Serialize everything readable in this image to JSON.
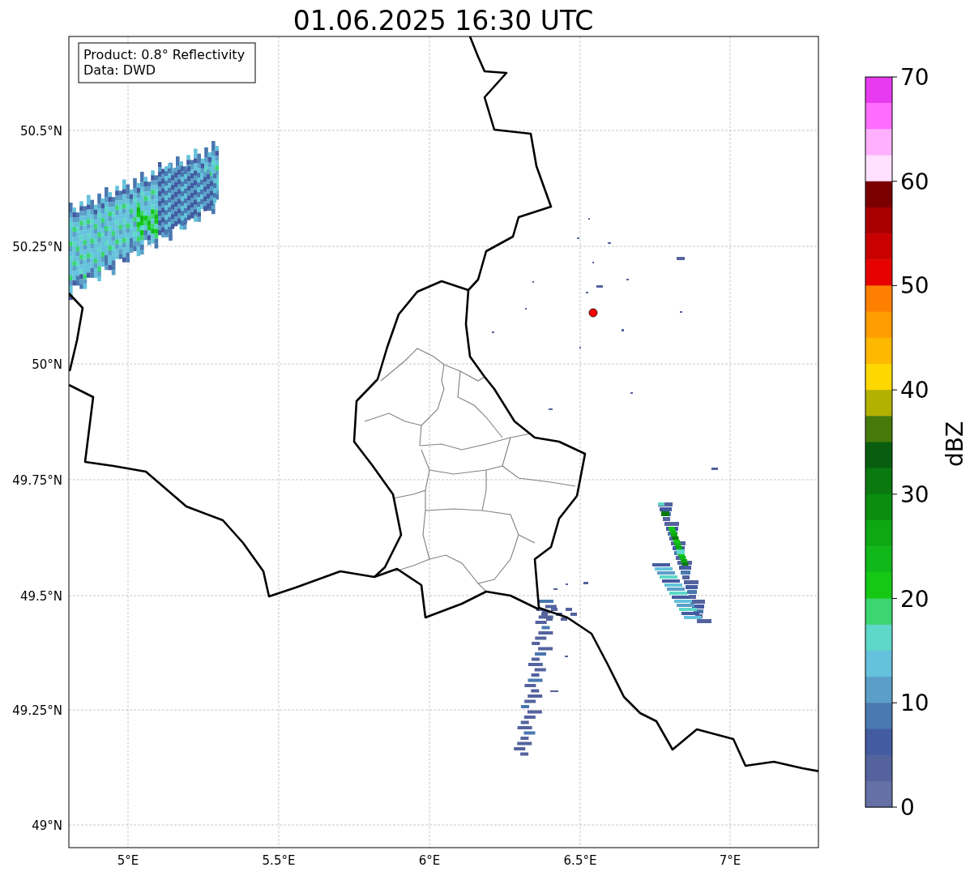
{
  "title": "01.06.2025 16:30 UTC",
  "legend": {
    "lines": [
      "Product: 0.8° Reflectivity",
      "Data: DWD"
    ]
  },
  "map": {
    "yticks": [
      "50.5°N",
      "50.25°N",
      "50°N",
      "49.75°N",
      "49.5°N",
      "49.25°N",
      "49°N"
    ],
    "xticks": [
      "5°E",
      "5.5°E",
      "6°E",
      "6.5°E",
      "7°E"
    ]
  },
  "colorbar": {
    "label": "dBZ",
    "ticks": [
      "70",
      "60",
      "50",
      "40",
      "30",
      "20",
      "10",
      "0"
    ],
    "segments": [
      {
        "color": "#e83af0"
      },
      {
        "color": "#ff6cff"
      },
      {
        "color": "#ffb0ff"
      },
      {
        "color": "#ffe0ff"
      },
      {
        "color": "#7a0000"
      },
      {
        "color": "#a80000"
      },
      {
        "color": "#c80000"
      },
      {
        "color": "#e60000"
      },
      {
        "color": "#ff7f00"
      },
      {
        "color": "#ff9c00"
      },
      {
        "color": "#ffb800"
      },
      {
        "color": "#ffd700"
      },
      {
        "color": "#b2b000"
      },
      {
        "color": "#457a0a"
      },
      {
        "color": "#085e0e"
      },
      {
        "color": "#0a7a10"
      },
      {
        "color": "#0b8e10"
      },
      {
        "color": "#0ea812"
      },
      {
        "color": "#10b81a"
      },
      {
        "color": "#14c814"
      },
      {
        "color": "#3cd670"
      },
      {
        "color": "#5ed8c8"
      },
      {
        "color": "#65c2dc"
      },
      {
        "color": "#5b9fc8"
      },
      {
        "color": "#4a78b0"
      },
      {
        "color": "#435ba0"
      },
      {
        "color": "#54639e"
      },
      {
        "color": "#6470a6"
      }
    ]
  }
}
